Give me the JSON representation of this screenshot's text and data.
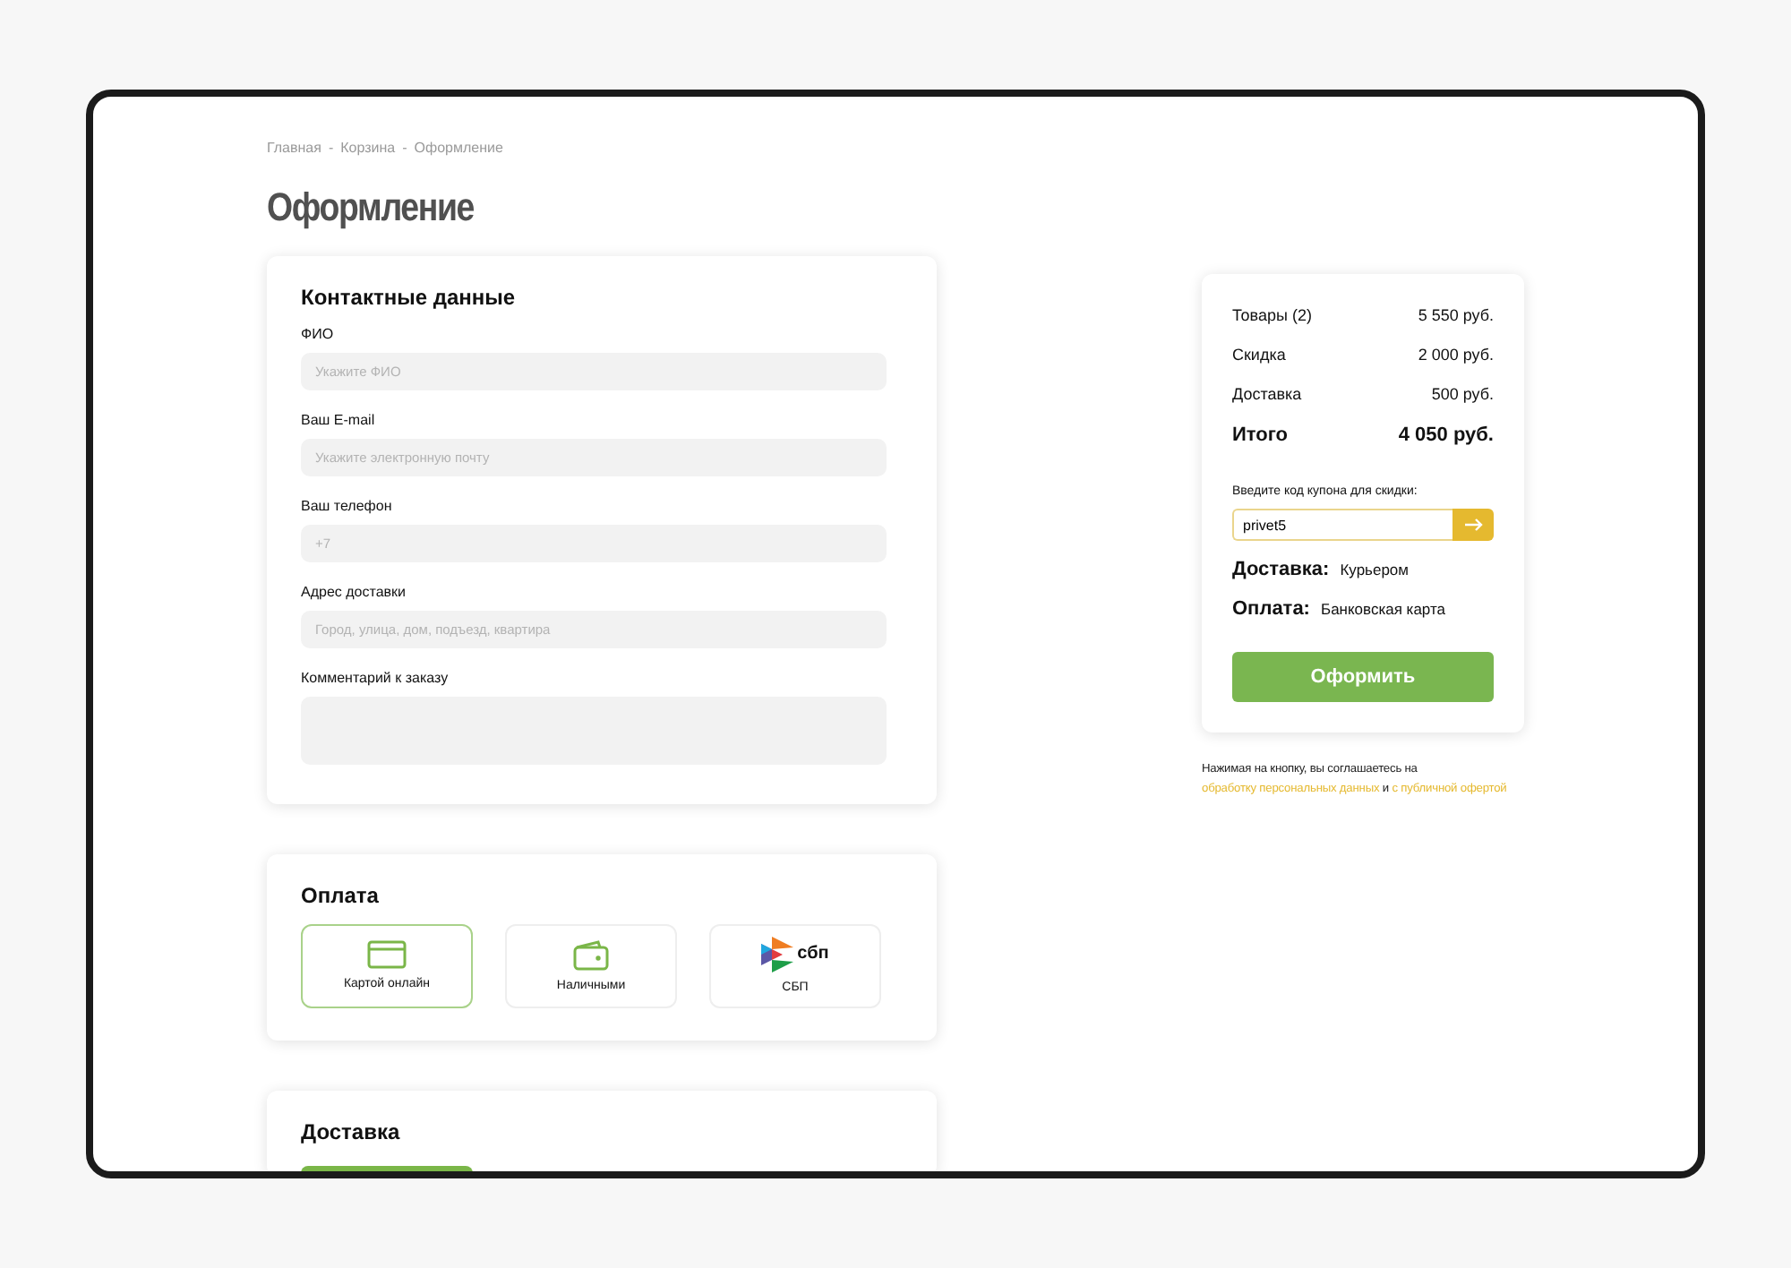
{
  "breadcrumbs": [
    "Главная",
    "Корзина",
    "Оформление"
  ],
  "breadcrumb_separator": "-",
  "title": "Оформление",
  "contact": {
    "heading": "Контактные данные",
    "fields": [
      {
        "label": "ФИО",
        "placeholder": "Укажите ФИО",
        "kind": "input"
      },
      {
        "label": "Ваш E-mail",
        "placeholder": "Укажите электронную почту",
        "kind": "input"
      },
      {
        "label": "Ваш телефон",
        "placeholder": "+7",
        "kind": "input"
      },
      {
        "label": "Адрес доставки",
        "placeholder": "Город, улица, дом, подъезд, квартира",
        "kind": "input"
      },
      {
        "label": "Комментарий к заказу",
        "kind": "textarea"
      }
    ]
  },
  "payment": {
    "heading": "Оплата",
    "options": [
      {
        "label": "Картой онлайн",
        "kind": "card",
        "selected": true
      },
      {
        "label": "Наличными",
        "kind": "wallet",
        "selected": false
      },
      {
        "label": "СБП",
        "kind": "sbp",
        "logo_text": "сбп",
        "selected": false
      }
    ]
  },
  "delivery": {
    "heading": "Доставка"
  },
  "summary": {
    "rows": [
      {
        "label": "Товары (2)",
        "value": "5 550 руб.",
        "kind": "line"
      },
      {
        "label": "Скидка",
        "value": "2 000 руб.",
        "kind": "line"
      },
      {
        "label": "Доставка",
        "value": "500 руб.",
        "kind": "line"
      },
      {
        "label": "Итого",
        "value": "4 050 руб.",
        "kind": "total"
      }
    ],
    "coupon": {
      "label": "Введите код купона для скидки:",
      "value": "privet5"
    },
    "details": [
      {
        "label": "Доставка:",
        "value": "Курьером"
      },
      {
        "label": "Оплата:",
        "value": "Банковская карта"
      }
    ],
    "submit": "Оформить"
  },
  "consent": [
    {
      "text": "Нажимая на кнопку, вы соглашаетесь на",
      "kind": "text"
    },
    {
      "text": "обработку персональных данных",
      "kind": "link"
    },
    {
      "text": "и",
      "kind": "text"
    },
    {
      "text": "с публичной офертой",
      "kind": "link"
    }
  ]
}
